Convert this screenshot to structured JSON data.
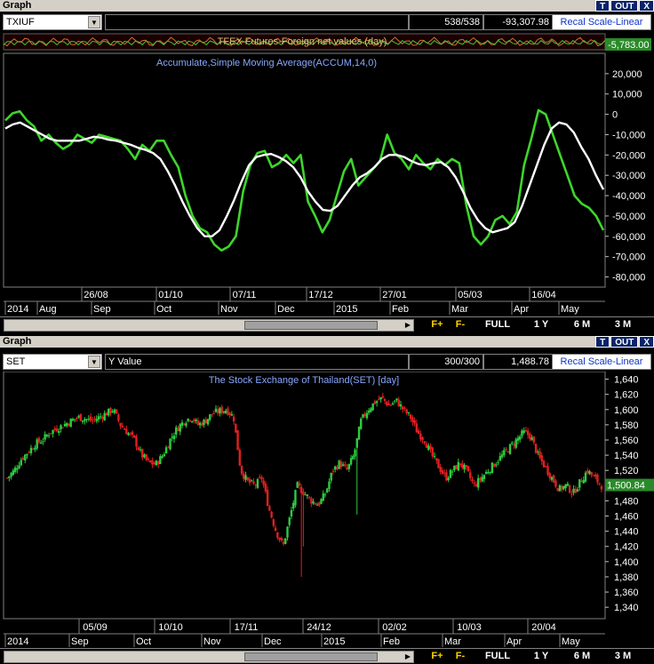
{
  "top_panel": {
    "title": "Graph",
    "buttons": {
      "t": "T",
      "out": "OUT",
      "close": "X"
    },
    "symbol": "TXIUF",
    "count": "538/538",
    "last_value": "-93,307.98",
    "recal_label": "Recal Scale-Linear",
    "indicator_title": "TFEX Futures-Foreign net values (day)",
    "chart_title": "Accumulate,Simple Moving Average(ACCUM,14,0)",
    "value_badge": "-5,783.00",
    "nav": {
      "fplus": "F+",
      "fminus": "F-",
      "full": "FULL",
      "y1": "1 Y",
      "m6": "6 M",
      "m3": "3 M"
    }
  },
  "bottom_panel": {
    "title": "Graph",
    "buttons": {
      "t": "T",
      "out": "OUT",
      "close": "X"
    },
    "symbol": "SET",
    "y_field": "Y Value",
    "count": "300/300",
    "last_value": "1,488.78",
    "recal_label": "Recal Scale-Linear",
    "chart_title": "The Stock Exchange of Thailand(SET) [day]",
    "value_badge": "1,500.84",
    "nav": {
      "fplus": "F+",
      "fminus": "F-",
      "full": "FULL",
      "y1": "1 Y",
      "m6": "6 M",
      "m3": "3 M"
    }
  },
  "colors": {
    "accum": "#3dd62a",
    "sma": "#ffffff",
    "up": "#2ecc40",
    "down": "#e02020",
    "label": "#88a8ff",
    "grid": "#404040"
  },
  "chart_data": [
    {
      "type": "line",
      "title": "Accumulate,Simple Moving Average(ACCUM,14,0)",
      "ylim": [
        -85000,
        30000
      ],
      "y_ticks": [
        20000,
        10000,
        0,
        -10000,
        -20000,
        -30000,
        -40000,
        -50000,
        -60000,
        -70000,
        -80000
      ],
      "y_tick_labels": [
        "20,000",
        "10,000",
        "0",
        "-10,000",
        "-20,000",
        "-30,000",
        "-40,000",
        "-50,000",
        "-60,000",
        "-70,000",
        "-80,000"
      ],
      "x_date_labels": [
        "26/08",
        "01/10",
        "07/11",
        "17/12",
        "27/01",
        "05/03",
        "16/04"
      ],
      "x_month_labels": [
        "2014",
        "Aug",
        "Sep",
        "Oct",
        "Nov",
        "Dec",
        "2015",
        "Feb",
        "Mar",
        "Apr",
        "May"
      ],
      "series": [
        {
          "name": "ACCUM",
          "color": "#3dd62a",
          "values": [
            -3000,
            500,
            1500,
            -3000,
            -6000,
            -13000,
            -10000,
            -14000,
            -17000,
            -15000,
            -10000,
            -12000,
            -14000,
            -10000,
            -11000,
            -12000,
            -13000,
            -17000,
            -22000,
            -15000,
            -18000,
            -13000,
            -13000,
            -20000,
            -26000,
            -40000,
            -50000,
            -56000,
            -58000,
            -64000,
            -67000,
            -65000,
            -60000,
            -38000,
            -25000,
            -19000,
            -18000,
            -26000,
            -24000,
            -20000,
            -24000,
            -20000,
            -43000,
            -50000,
            -58000,
            -52000,
            -40000,
            -28000,
            -22000,
            -35000,
            -31000,
            -27000,
            -23000,
            -10000,
            -19000,
            -22000,
            -27000,
            -20000,
            -24000,
            -27000,
            -22000,
            -25000,
            -22000,
            -24000,
            -45000,
            -60000,
            -64000,
            -60000,
            -52000,
            -50000,
            -54000,
            -48000,
            -25000,
            -12000,
            2000,
            0,
            -10000,
            -20000,
            -30000,
            -40000,
            -44000,
            -46000,
            -50000,
            -57000
          ]
        },
        {
          "name": "SMA",
          "color": "#ffffff",
          "values": [
            -7000,
            -5000,
            -4000,
            -6000,
            -8000,
            -10000,
            -12000,
            -13000,
            -13000,
            -13000,
            -13000,
            -12000,
            -11000,
            -11500,
            -12500,
            -13000,
            -14000,
            -15000,
            -16500,
            -17500,
            -19000,
            -22000,
            -28000,
            -35000,
            -43000,
            -50000,
            -56000,
            -60000,
            -60000,
            -57000,
            -50000,
            -42000,
            -33000,
            -25000,
            -21000,
            -20000,
            -19500,
            -21000,
            -23000,
            -26000,
            -31000,
            -38000,
            -43000,
            -47000,
            -47500,
            -45000,
            -40000,
            -35000,
            -31000,
            -29000,
            -26000,
            -22000,
            -20000,
            -20000,
            -21000,
            -23000,
            -24500,
            -25000,
            -24000,
            -23500,
            -26000,
            -31000,
            -38000,
            -46000,
            -52000,
            -56000,
            -58000,
            -57000,
            -56000,
            -53000,
            -45000,
            -35000,
            -25000,
            -15000,
            -7000,
            -4000,
            -5000,
            -9000,
            -16000,
            -22000,
            -30000,
            -37000
          ]
        }
      ]
    },
    {
      "type": "candlestick",
      "title": "The Stock Exchange of Thailand(SET) [day]",
      "ylim": [
        1325,
        1650
      ],
      "y_ticks": [
        1640,
        1620,
        1600,
        1580,
        1560,
        1540,
        1520,
        1500,
        1480,
        1460,
        1440,
        1420,
        1400,
        1380,
        1360,
        1340
      ],
      "y_tick_labels": [
        "1,640",
        "1,620",
        "1,600",
        "1,580",
        "1,560",
        "1,540",
        "1,520",
        "1,500",
        "1,480",
        "1,460",
        "1,440",
        "1,420",
        "1,400",
        "1,380",
        "1,360",
        "1,340"
      ],
      "x_date_labels": [
        "05/09",
        "10/10",
        "17/11",
        "24/12",
        "02/02",
        "10/03",
        "20/04"
      ],
      "x_month_labels": [
        "2014",
        "Sep",
        "Oct",
        "Nov",
        "Dec",
        "2015",
        "Feb",
        "Mar",
        "Apr",
        "May"
      ],
      "closes": [
        1510,
        1520,
        1535,
        1545,
        1555,
        1560,
        1570,
        1575,
        1580,
        1585,
        1590,
        1588,
        1585,
        1590,
        1595,
        1600,
        1580,
        1570,
        1560,
        1540,
        1530,
        1528,
        1540,
        1560,
        1575,
        1585,
        1590,
        1580,
        1585,
        1595,
        1598,
        1600,
        1590,
        1520,
        1505,
        1500,
        1510,
        1470,
        1440,
        1420,
        1460,
        1500,
        1490,
        1480,
        1475,
        1490,
        1520,
        1530,
        1520,
        1540,
        1585,
        1600,
        1610,
        1615,
        1605,
        1612,
        1600,
        1590,
        1570,
        1560,
        1540,
        1525,
        1510,
        1520,
        1530,
        1518,
        1500,
        1510,
        1520,
        1530,
        1540,
        1550,
        1560,
        1570,
        1565,
        1540,
        1525,
        1510,
        1495,
        1500,
        1490,
        1505,
        1520,
        1510,
        1500
      ]
    }
  ]
}
